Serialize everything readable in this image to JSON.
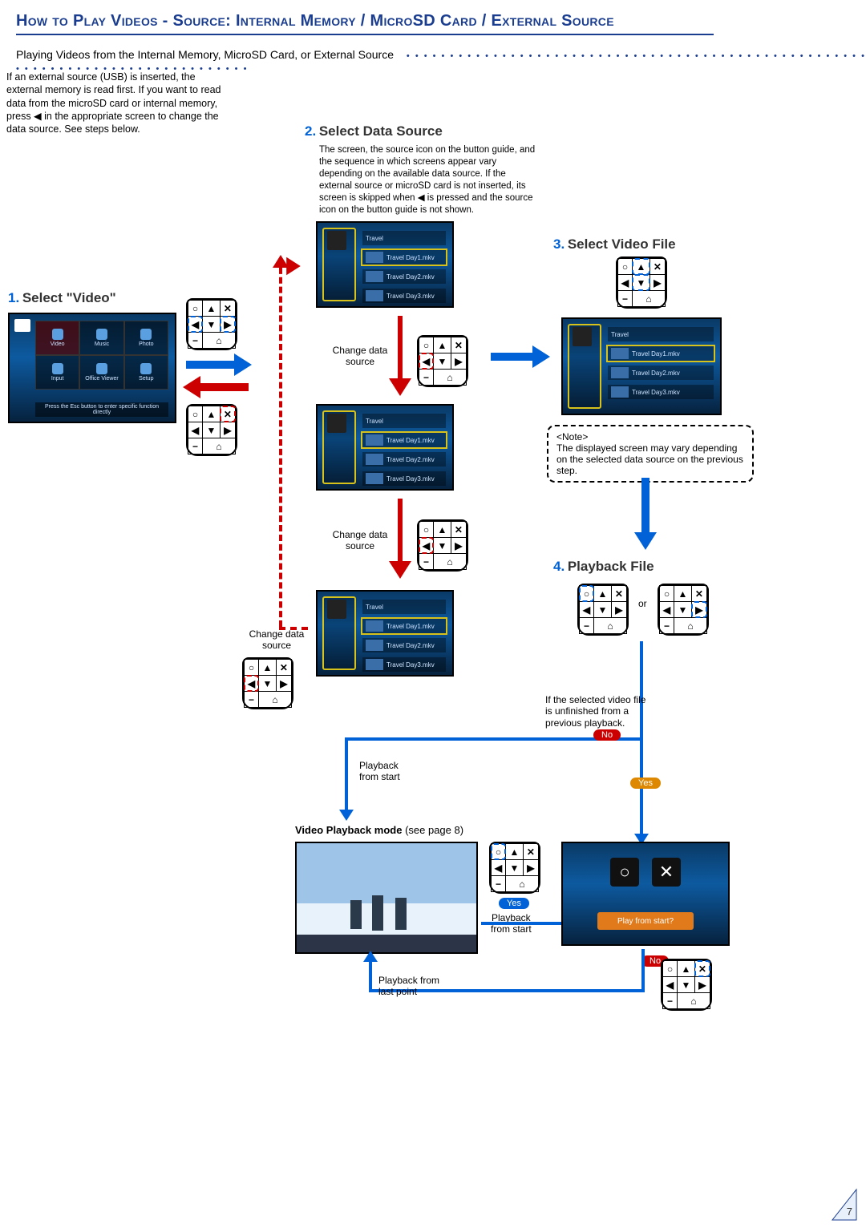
{
  "header": {
    "page_title": "How to Play Videos - Source: Internal Memory / MicroSD Card / External Source",
    "subtitle": "Playing Videos from the Internal Memory, MicroSD Card, or External Source",
    "intro": "If an external source (USB) is inserted, the external memory is read first. If you want to read data from the microSD card or internal memory, press ◀ in the appropriate screen to change the data source. See steps below."
  },
  "steps": {
    "s1": {
      "num": "1.",
      "title": "Select \"Video\""
    },
    "s2": {
      "num": "2.",
      "title": "Select Data Source",
      "body": "The screen, the source icon on the button guide, and the sequence in which screens appear vary depending on the available data source. If the external source or microSD card is not inserted, its screen is skipped when ◀ is pressed and the source icon on the button guide is not shown."
    },
    "s3": {
      "num": "3.",
      "title": "Select Video File"
    },
    "s4": {
      "num": "4.",
      "title": "Playback File"
    }
  },
  "menu": {
    "items": [
      "Video",
      "Music",
      "Photo",
      "Input",
      "Office Viewer",
      "Setup"
    ],
    "footer": "Press the Esc button to enter specific function directly"
  },
  "video_list": {
    "folder": "Travel",
    "files": [
      "Travel Day1.mkv",
      "Travel Day2.mkv",
      "Travel Day3.mkv"
    ]
  },
  "captions": {
    "change_src": "Change data\nsource",
    "note_label": "<Note>",
    "note_body": "The displayed screen may vary depending on the selected data source on the previous step.",
    "or": "or",
    "unfinished": "If the selected video file is unfinished from a previous playback.",
    "yes": "Yes",
    "no": "No",
    "pb_start": "Playback\nfrom start",
    "pb_last": "Playback from\nlast point",
    "mode_title": "Video Playback mode",
    "mode_see": "(see page 8)",
    "play_from_start": "Play from start?"
  },
  "page_number": "7",
  "pad_labels": {
    "r1c1": "○",
    "r1c2": "▲",
    "r1c3": "✕",
    "r2c1": "◀",
    "r2c2": "▼",
    "r2c3": "▶",
    "r3c1": "−",
    "r3c2": "⌂"
  }
}
